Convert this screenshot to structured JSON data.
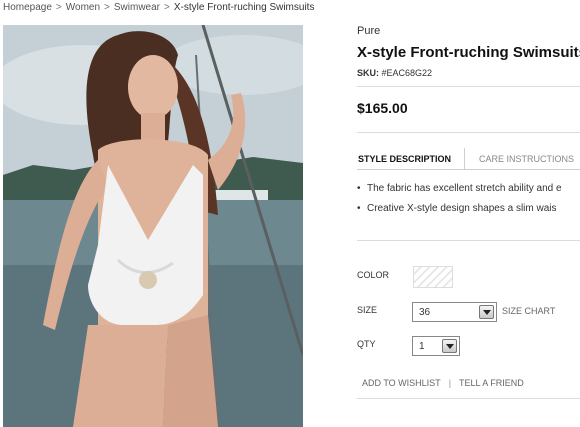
{
  "breadcrumb": {
    "items": [
      "Homepage",
      "Women",
      "Swimwear"
    ],
    "separator": ">",
    "current": "X-style Front-ruching Swimsuits"
  },
  "product": {
    "brand": "Pure",
    "title": "X-style Front-ruching Swimsuits",
    "sku_label": "SKU:",
    "sku_value": "#EAC68G22",
    "price": "$165.00"
  },
  "tabs": [
    {
      "label": "STYLE DESCRIPTION",
      "active": true
    },
    {
      "label": "CARE INSTRUCTIONS",
      "active": false
    }
  ],
  "description": {
    "bullet": "•",
    "items": [
      "The fabric has excellent stretch ability and e",
      "Creative X-style design shapes a slim wais"
    ]
  },
  "options": {
    "color_label": "COLOR",
    "size_label": "SIZE",
    "size_value": "36",
    "size_chart_label": "SIZE CHART",
    "qty_label": "QTY",
    "qty_value": "1"
  },
  "actions": {
    "wishlist": "ADD TO WISHLIST",
    "divider": "|",
    "friend": "TELL A FRIEND"
  },
  "colors": {
    "text": "#222222",
    "muted": "#888888",
    "border": "#dcdcdc"
  }
}
